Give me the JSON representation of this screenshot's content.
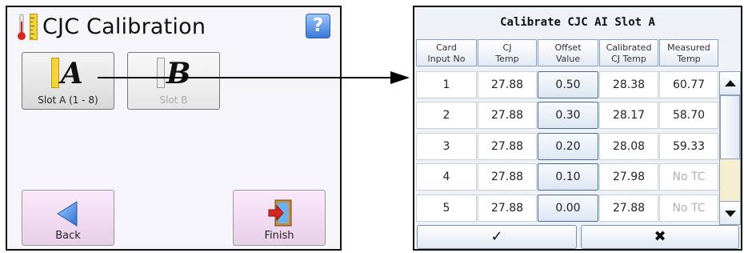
{
  "left_panel": {
    "title": "CJC Calibration",
    "help_label": "?",
    "slot_a": {
      "letter": "A",
      "label": "Slot A (1 - 8)"
    },
    "slot_b": {
      "letter": "B",
      "label": "Slot B"
    },
    "back_label": "Back",
    "finish_label": "Finish"
  },
  "right_panel": {
    "title": "Calibrate CJC AI Slot A",
    "headers": [
      [
        "Card",
        "Input No"
      ],
      [
        "CJ",
        "Temp"
      ],
      [
        "Offset",
        "Value"
      ],
      [
        "Calibrated",
        "CJ Temp"
      ],
      [
        "Measured",
        "Temp"
      ]
    ],
    "rows": [
      {
        "input": "1",
        "cj": "27.88",
        "offset": "0.50",
        "calibrated": "28.38",
        "measured": "60.77"
      },
      {
        "input": "2",
        "cj": "27.88",
        "offset": "0.30",
        "calibrated": "28.17",
        "measured": "58.70"
      },
      {
        "input": "3",
        "cj": "27.88",
        "offset": "0.20",
        "calibrated": "28.08",
        "measured": "59.33"
      },
      {
        "input": "4",
        "cj": "27.88",
        "offset": "0.10",
        "calibrated": "27.98",
        "measured": "No TC"
      },
      {
        "input": "5",
        "cj": "27.88",
        "offset": "0.00",
        "calibrated": "27.88",
        "measured": "No TC"
      }
    ],
    "ok_label": "✓",
    "cancel_label": "✖"
  },
  "colors": {
    "accent_blue": "#3a78d8",
    "ruler_yellow": "#f3d43a",
    "nav_pink": "#e8cfe8",
    "scroll_track": "#f5efcf",
    "arrow_red": "#d7261e"
  }
}
